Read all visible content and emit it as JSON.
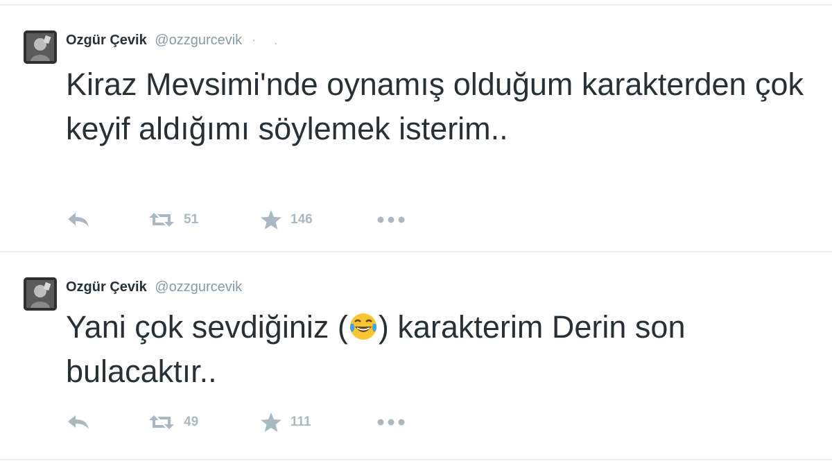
{
  "tweets": [
    {
      "author_name": "Ozgür Çevik",
      "handle": "@ozzgurcevik",
      "separator": "· .",
      "text": "Kiraz Mevsimi'nde oynamış olduğum karakterden çok keyif aldığımı söylemek isterim..",
      "retweet_count": "51",
      "favorite_count": "146"
    },
    {
      "author_name": "Ozgür Çevik",
      "handle": "@ozzgurcevik",
      "text_before": "Yani çok sevdiğiniz (",
      "emoji": "face-with-tears-of-joy",
      "text_after": ") karakterim Derin son bulacaktır..",
      "retweet_count": "49",
      "favorite_count": "111"
    }
  ],
  "icons": {
    "reply": "reply-icon",
    "retweet": "retweet-icon",
    "favorite": "star-icon",
    "more": "more-dots-icon"
  },
  "colors": {
    "text": "#292f33",
    "muted": "#8899a6",
    "action": "#aab8c2",
    "divider": "#e6ecf0"
  }
}
